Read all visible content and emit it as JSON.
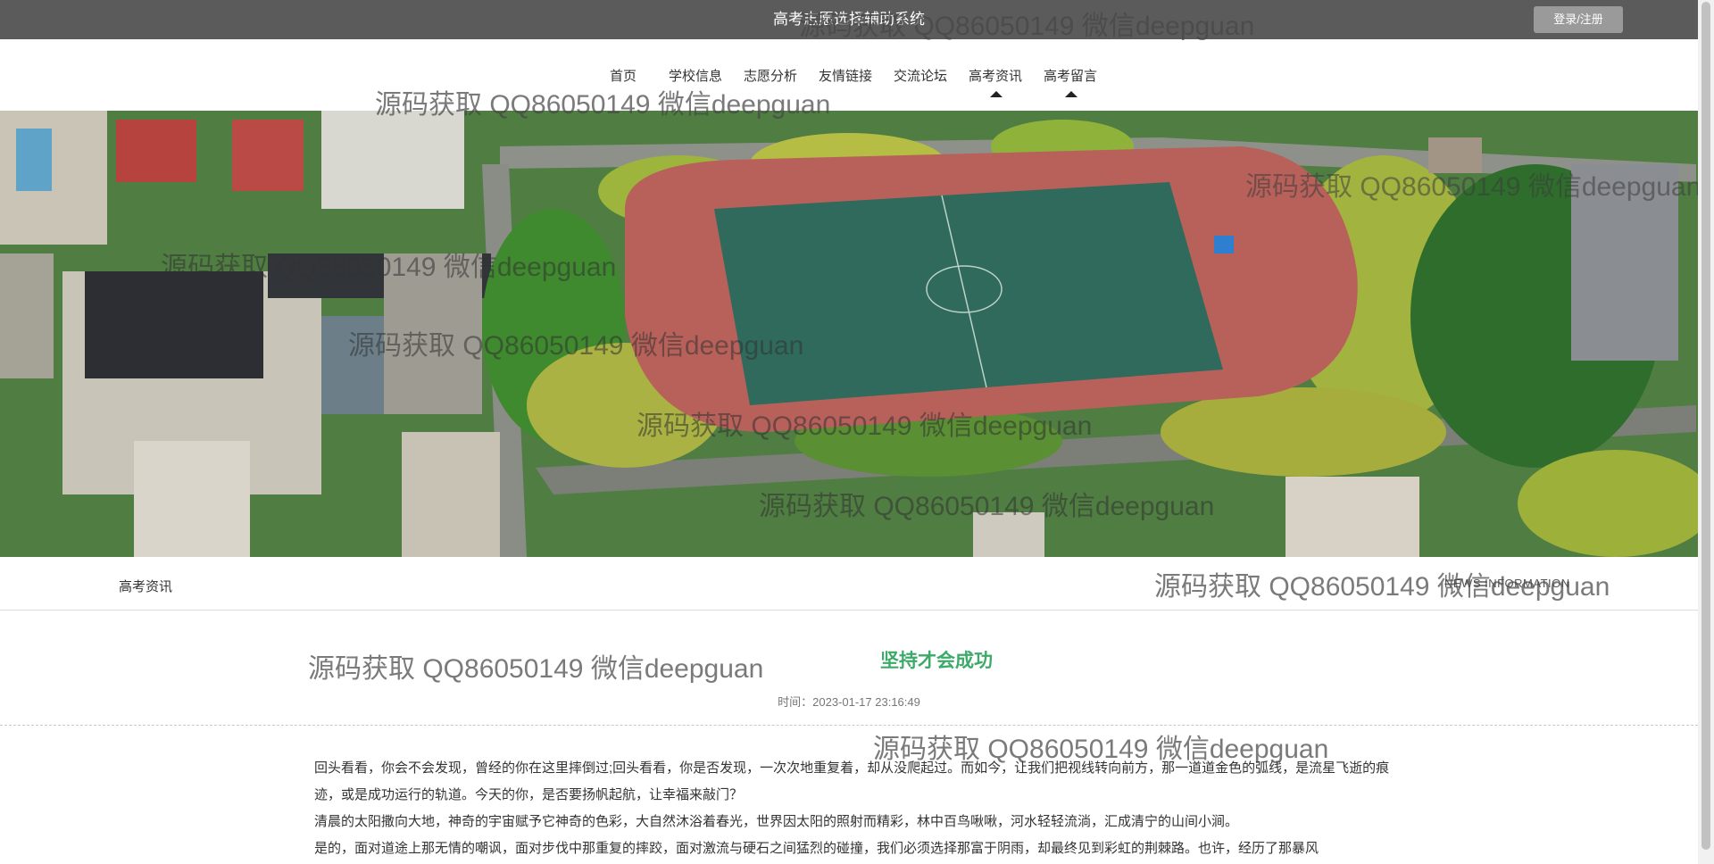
{
  "header": {
    "site_title": "高考志愿选择辅助系统",
    "login_label": "登录/注册"
  },
  "nav": {
    "items": [
      {
        "label": "首页"
      },
      {
        "label": "学校信息"
      },
      {
        "label": "志愿分析"
      },
      {
        "label": "友情链接"
      },
      {
        "label": "交流论坛"
      },
      {
        "label": "高考资讯",
        "active": true
      },
      {
        "label": "高考留言"
      }
    ]
  },
  "section": {
    "title": "高考资讯",
    "subtitle_en": "NEWS INFORMATION"
  },
  "article": {
    "title": "坚持才会成功",
    "meta": "时间：2023-01-17 23:16:49",
    "paragraphs": [
      "回头看看，你会不会发现，曾经的你在这里摔倒过;回头看看，你是否发现，一次次地重复着，却从没爬起过。而如今，让我们把视线转向前方，那一道道金色的弧线，是流星飞逝的痕迹，或是成功运行的轨道。今天的你，是否要扬帆起航，让幸福来敲门？",
      "清晨的太阳撒向大地，神奇的宇宙赋予它神奇的色彩，大自然沐浴着春光，世界因太阳的照射而精彩，林中百鸟啾啾，河水轻轻流淌，汇成清宁的山间小涧。",
      "是的，面对道途上那无情的嘲讽，面对步伐中那重复的摔跤，面对激流与硬石之间猛烈的碰撞，我们必须选择那富于阴雨，却最终见到彩虹的荆棘路。也许，经历了那暴风"
    ]
  },
  "watermark": {
    "text": "源码获取 QQ86050149 微信deepguan"
  },
  "colors": {
    "topbar": "#5b5b5b",
    "accent_title": "#3daa6a",
    "login_button": "#9a9a9a"
  }
}
